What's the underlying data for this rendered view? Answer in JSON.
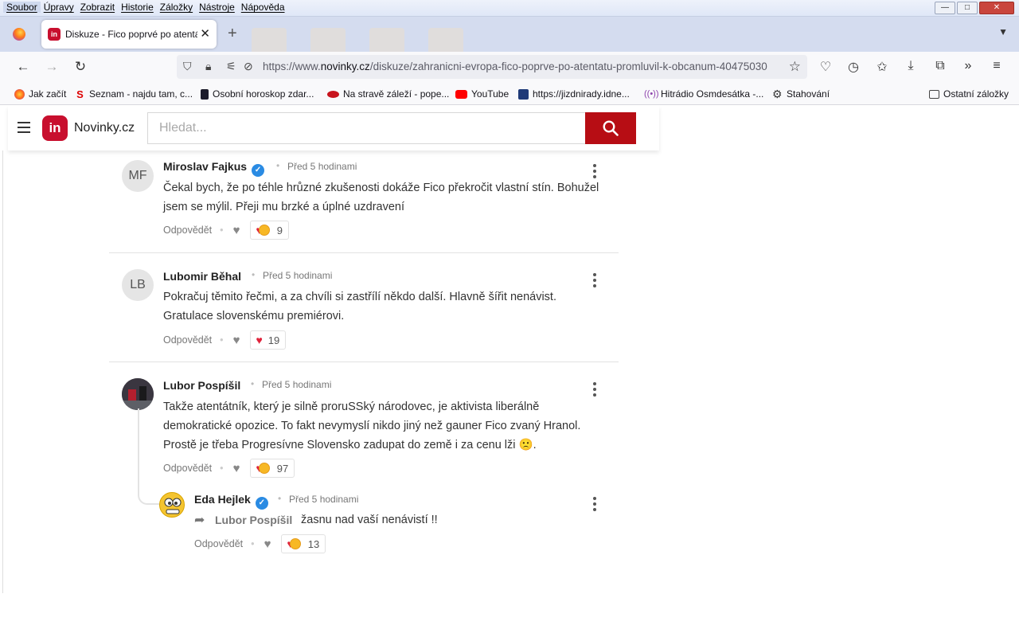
{
  "menu": [
    "Soubor",
    "Úpravy",
    "Zobrazit",
    "Historie",
    "Záložky",
    "Nástroje",
    "Nápověda"
  ],
  "window_buttons": {
    "minimize": "—",
    "maximize": "□",
    "close": "✕"
  },
  "tab": {
    "title": "Diskuze - Fico poprvé po atentátu promluvil",
    "favicon": "in"
  },
  "url": {
    "prefix": "https://www.",
    "domain": "novinky.cz",
    "path": "/diskuze/zahranicni-evropa-fico-poprve-po-atentatu-promluvil-k-obcanum-40475030"
  },
  "bookmarks": [
    {
      "label": "Jak začít",
      "icon": "firefox-icon"
    },
    {
      "label": "Seznam - najdu tam, c...",
      "icon": "seznam-icon"
    },
    {
      "label": "Osobní horoskop zdar...",
      "icon": "horoscope-icon"
    },
    {
      "label": "Na stravě záleží - pope...",
      "icon": "food-icon"
    },
    {
      "label": "YouTube",
      "icon": "youtube-icon"
    },
    {
      "label": "https://jizdnirady.idne...",
      "icon": "timetable-icon"
    },
    {
      "label": "Hitrádio Osmdesátka -...",
      "icon": "radio-icon"
    },
    {
      "label": "Stahování",
      "icon": "gear-icon"
    },
    {
      "label": "Ostatní záložky",
      "icon": "folder-icon"
    }
  ],
  "site": {
    "logo_text": "in",
    "name": "Novinky.cz",
    "search_placeholder": "Hledat..."
  },
  "actions": {
    "reply": "Odpovědět"
  },
  "comments": [
    {
      "initials": "MF",
      "author": "Miroslav Fajkus",
      "verified": true,
      "time": "Před 5 hodinami",
      "text": "Čekal bych, že po téhle hrůzné zkušenosti dokáže Fico překročit vlastní stín. Bohužel jsem se mýlil. Přeji mu brzké a úplné uzdravení",
      "reactions": "9"
    },
    {
      "initials": "LB",
      "author": "Lubomir Běhal",
      "verified": false,
      "time": "Před 5 hodinami",
      "text": "Pokračuj těmito řečmi, a za chvíli si zastřílí někdo další. Hlavně šířit nenávist. Gratulace slovenskému premiérovi.",
      "reactions": "19"
    },
    {
      "initials": "",
      "author": "Lubor Pospíšil",
      "verified": false,
      "time": "Před 5 hodinami",
      "text": "Takže atentátník, který je silně proruSSký národovec, je aktivista liberálně demokratické opozice. To fakt nevymyslí nikdo jiný než gauner Fico zvaný Hranol. Prostě je třeba Progresívne Slovensko zadupat do země i za cenu lži 🙁.",
      "reactions": "97"
    }
  ],
  "reply": {
    "author": "Eda Hejlek",
    "verified": true,
    "time": "Před 5 hodinami",
    "reply_to": "Lubor Pospíšil",
    "text": "žasnu nad vaší nenávistí !!",
    "reactions": "13"
  }
}
